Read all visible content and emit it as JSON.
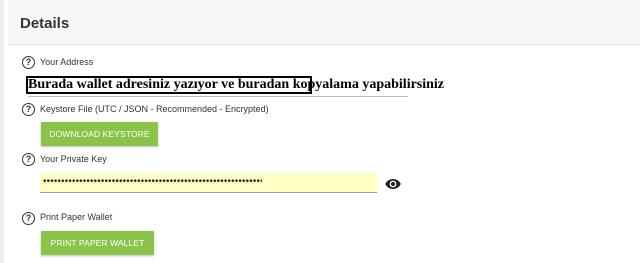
{
  "header": {
    "title": "Details"
  },
  "address": {
    "label": "Your Address",
    "value": "Burada wallet adresiniz yazıyor ve buradan kopyalama yapabilirsiniz"
  },
  "keystore": {
    "label": "Keystore File (UTC / JSON - Recommended - Encrypted)",
    "button": "DOWNLOAD KEYSTORE"
  },
  "private_key": {
    "label": "Your Private Key",
    "value": "••••••••••••••••••••••••••••••••••••••••••••••••••••••••••••••••"
  },
  "paper": {
    "label": "Print Paper Wallet",
    "button": "PRINT PAPER WALLET"
  },
  "help_glyph": "?",
  "icons": {
    "help": "help-circle-icon",
    "toggle": "eye-icon"
  },
  "colors": {
    "button": "#8bc34a",
    "key_bg": "#ffffc4"
  }
}
